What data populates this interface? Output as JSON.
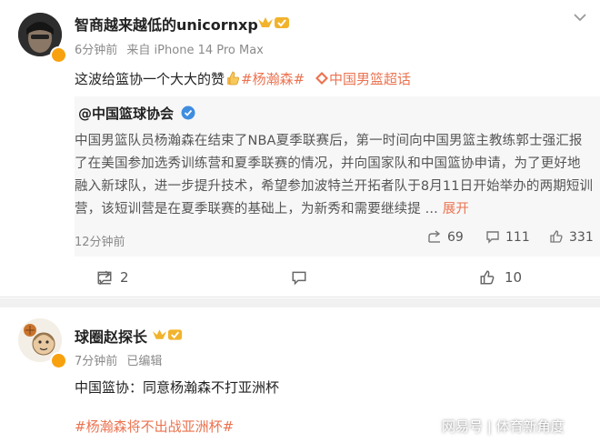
{
  "post1": {
    "username": "智商越来越低的unicornxp",
    "time": "6分钟前",
    "source": "来自 iPhone 14 Pro Max",
    "text_main": "这波给篮协一个大大的赞",
    "tag1": "#杨瀚森#",
    "tag2": "中国男篮超话",
    "quote": {
      "author": "@中国篮球协会",
      "lines": [
        "中国男篮队员杨瀚森在结束了NBA夏季联赛后，第一时间向中国男篮主教练郭士强汇报",
        "了在美国参加选秀训练营和夏季联赛的情况，并向国家队和中国篮协申请，为了更好地",
        "融入新球队，进一步提升技术，希望参加波特兰开拓者队于8月11日开始举办的两期短训",
        "营，该短训营是在夏季联赛的基础上，为新秀和需要继续提 ..."
      ],
      "expand": "展开",
      "time": "12分钟前",
      "shares": "69",
      "comments": "111",
      "likes": "331"
    },
    "actions": {
      "shares": "",
      "comments": "2",
      "likes": "10"
    }
  },
  "post2": {
    "username": "球圈赵探长",
    "time": "7分钟前",
    "edited": "已编辑",
    "text": "中国篮协：同意杨瀚森不打亚洲杯",
    "tag": "#杨瀚森将不出战亚洲杯#"
  },
  "watermark": {
    "brand": "网易号",
    "sep": "|",
    "account": "体育新角度"
  },
  "colors": {
    "accent": "#eb7350",
    "verified_orange": "#f8a10f",
    "verified_blue": "#3f8de0"
  }
}
